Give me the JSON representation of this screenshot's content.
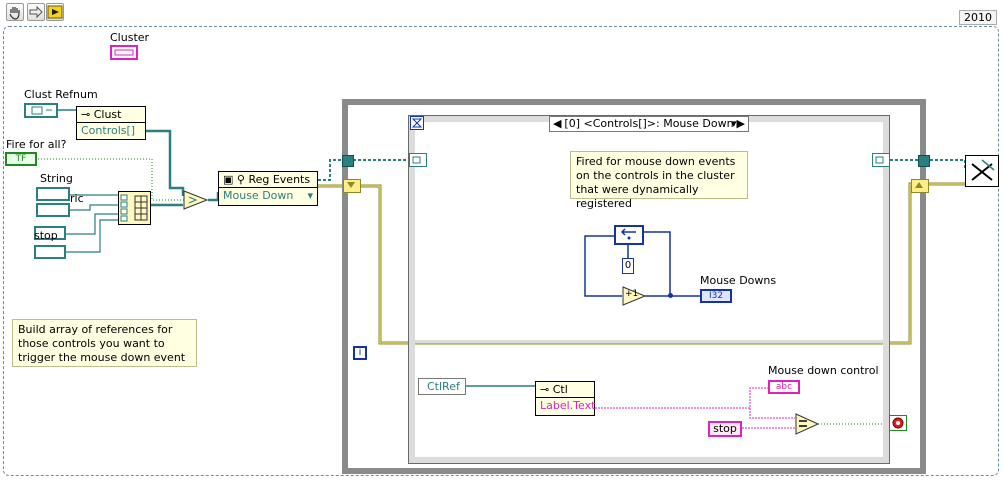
{
  "toolbar": {
    "tools": [
      "hand-tool-icon",
      "arrow-tool-icon",
      "run-icon"
    ],
    "version_badge": "2010"
  },
  "front_labels": {
    "cluster": "Cluster",
    "clust_refnum": "Clust Refnum",
    "fire_for_all": "Fire for all?",
    "string": "String",
    "numeric_partial": "ric",
    "stop_small": "stop",
    "mouse_downs": "Mouse Downs",
    "mouse_down_control": "Mouse down control"
  },
  "nodes": {
    "clust_property": {
      "title": "Clust",
      "item": "Controls[]"
    },
    "reg_events": {
      "title": "Reg Events",
      "item": "Mouse Down"
    },
    "ctl_property": {
      "title": "Ctl",
      "item": "Label.Text"
    },
    "ctlref": "CtlRef",
    "tf_constant": "TF",
    "zero_constant": "0",
    "increment": "+1",
    "i32_indicator": "I32",
    "abc_indicator": "abc",
    "stop_terminal": "stop",
    "iteration": "i"
  },
  "event_structure": {
    "case_label": "[0] <Controls[]>: Mouse Down"
  },
  "comments": {
    "fired_for": "Fired for mouse down events on the controls in the cluster that were dynamically registered",
    "build_array": "Build array of references for those controls you want to trigger the mouse down event"
  },
  "colors": {
    "refnum_wire": "#2a7f80",
    "event_wire": "#8a8a2a",
    "string_wire": "#e020c0",
    "bool_wire": "#1f8a1f",
    "numeric_wire": "#1533a8",
    "loop_frame": "#8a8a8a"
  }
}
